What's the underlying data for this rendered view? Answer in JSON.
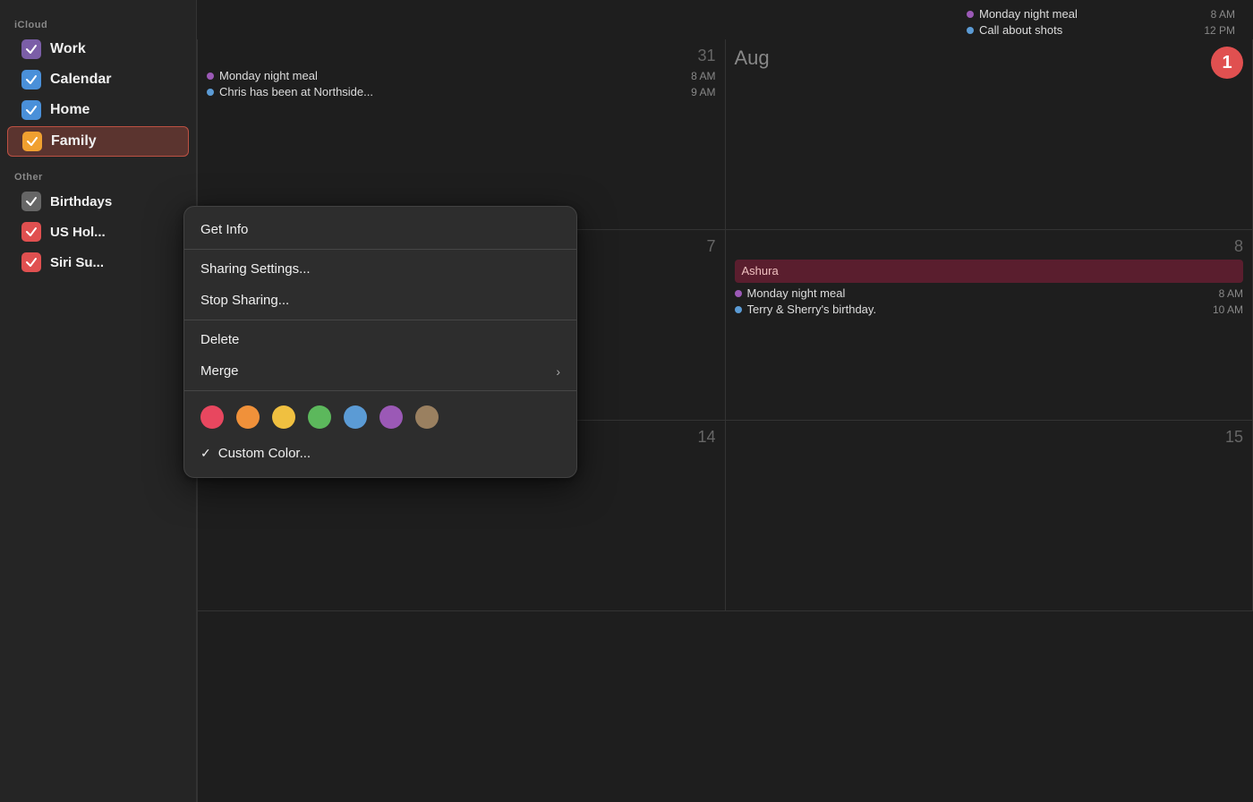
{
  "sidebar": {
    "icloud_label": "iCloud",
    "other_label": "Other",
    "items": [
      {
        "id": "work",
        "label": "Work",
        "color": "#7b5ea7",
        "checked": true
      },
      {
        "id": "calendar",
        "label": "Calendar",
        "color": "#4a90d9",
        "checked": true
      },
      {
        "id": "home",
        "label": "Home",
        "color": "#4a90d9",
        "checked": true
      },
      {
        "id": "family",
        "label": "Family",
        "color": "#f0a030",
        "checked": true,
        "selected": true
      },
      {
        "id": "birthdays",
        "label": "Birthdays",
        "color": "#888",
        "checked": true
      },
      {
        "id": "us-holidays",
        "label": "US Holidays",
        "color": "#e05050",
        "checked": true
      },
      {
        "id": "siri-suggestions",
        "label": "Siri Suggestions",
        "color": "#e05050",
        "checked": true
      }
    ]
  },
  "context_menu": {
    "items": [
      {
        "id": "get-info",
        "label": "Get Info",
        "type": "item"
      },
      {
        "id": "sep1",
        "type": "separator"
      },
      {
        "id": "sharing-settings",
        "label": "Sharing Settings...",
        "type": "item"
      },
      {
        "id": "stop-sharing",
        "label": "Stop Sharing...",
        "type": "item"
      },
      {
        "id": "sep2",
        "type": "separator"
      },
      {
        "id": "delete",
        "label": "Delete",
        "type": "item"
      },
      {
        "id": "merge",
        "label": "Merge",
        "type": "item-arrow"
      },
      {
        "id": "sep3",
        "type": "separator"
      }
    ],
    "colors": [
      {
        "id": "red",
        "hex": "#e8475f"
      },
      {
        "id": "orange",
        "hex": "#f0913a"
      },
      {
        "id": "yellow",
        "hex": "#f0c040"
      },
      {
        "id": "green",
        "hex": "#5cb85c"
      },
      {
        "id": "blue",
        "hex": "#5b9bd5"
      },
      {
        "id": "purple",
        "hex": "#9b59b6"
      },
      {
        "id": "brown",
        "hex": "#9a8060"
      }
    ],
    "custom_color_label": "Custom Color...",
    "custom_color_check": "✓"
  },
  "calendar": {
    "top_events": [
      {
        "title": "Monday night meal",
        "time": "8 AM",
        "dot_color": "#9b59b6"
      },
      {
        "title": "Call about shots",
        "time": "12 PM",
        "dot_color": "#5b9bd5"
      }
    ],
    "cells": [
      {
        "id": "cell-31",
        "date": "31",
        "events": [
          {
            "title": "Monday night meal",
            "time": "8 AM",
            "dot_color": "#9b59b6"
          },
          {
            "title": "Chris has been at Northside...",
            "time": "9 AM",
            "dot_color": "#5b9bd5"
          }
        ]
      },
      {
        "id": "cell-aug1",
        "month": "Aug",
        "date": "1",
        "has_badge": true,
        "events": []
      },
      {
        "id": "cell-7",
        "date": "7",
        "events": []
      },
      {
        "id": "cell-8",
        "date": "8",
        "events": [
          {
            "title": "Ashura",
            "type": "block",
            "block_color": "#5a1e2e"
          },
          {
            "title": "Monday night meal",
            "time": "8 AM",
            "dot_color": "#9b59b6"
          },
          {
            "title": "Terry & Sherry's birthday.",
            "time": "10 AM",
            "dot_color": "#5b9bd5"
          }
        ]
      },
      {
        "id": "cell-14",
        "date": "14",
        "events": []
      },
      {
        "id": "cell-15",
        "date": "15",
        "events": []
      }
    ]
  }
}
